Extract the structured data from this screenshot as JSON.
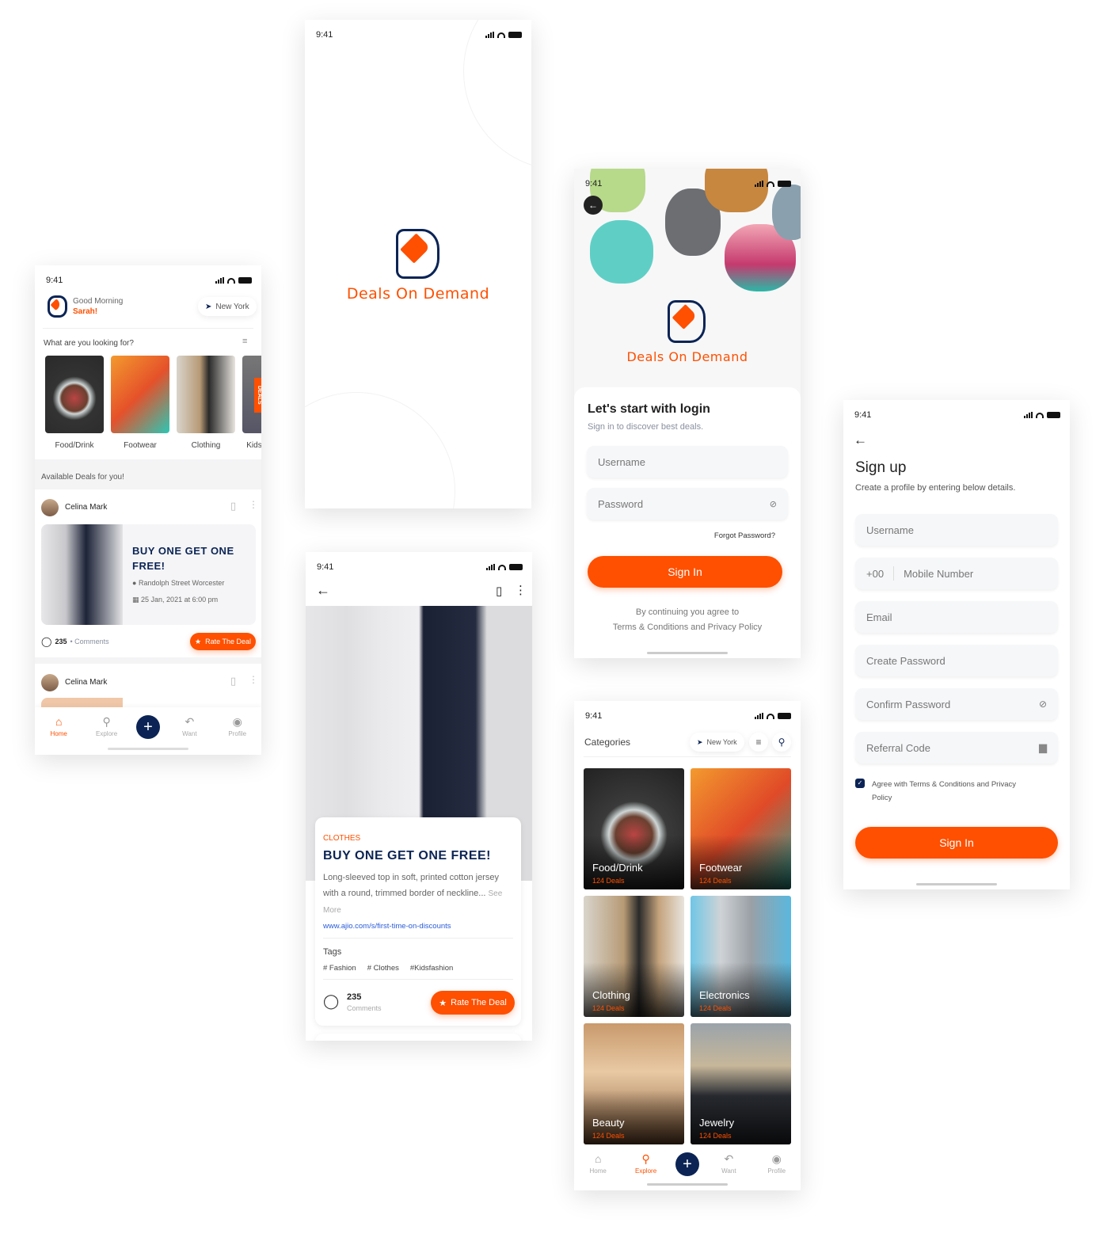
{
  "brand": {
    "name": "Deals On Demand",
    "orange": "#fe5000",
    "navy": "#0b2455"
  },
  "status_time": "9:41",
  "home": {
    "greeting": "Good Morning",
    "user": "Sarah!",
    "location": "New York",
    "looking_for": "What are you looking for?",
    "categories": [
      "Food/Drink",
      "Footwear",
      "Clothing",
      "Kids"
    ],
    "deals_ribbon": "DEALS",
    "available": "Available Deals for you!",
    "post": {
      "author": "Celina Mark",
      "title": "BUY ONE GET ONE FREE!",
      "place": "Randolph Street Worcester",
      "date": "25 Jan, 2021 at 6:00 pm",
      "comments_count": "235",
      "comments_label": "• Comments",
      "rate": "Rate The Deal"
    },
    "post2_author": "Celina Mark"
  },
  "nav": {
    "home": "Home",
    "explore": "Explore",
    "want": "Want",
    "profile": "Profile"
  },
  "detail": {
    "category": "CLOTHES",
    "title": "BUY ONE GET ONE FREE!",
    "desc": "Long-sleeved top in soft, printed cotton jersey with a round, trimmed border of neckline...",
    "see_more": "See More",
    "link": "www.ajio.com/s/first-time-on-discounts",
    "tags_label": "Tags",
    "tags": [
      "# Fashion",
      "# Clothes",
      "#Kidsfashion"
    ],
    "comments_count": "235",
    "comments_label": "Comments",
    "rate": "Rate The Deal"
  },
  "login": {
    "title": "Let's start with login",
    "subtitle": "Sign in to discover best deals.",
    "username": "Username",
    "password": "Password",
    "forgot": "Forgot Password?",
    "sign_in": "Sign In",
    "agree1": "By continuing you agree to",
    "agree2": "Terms & Conditions and Privacy Policy"
  },
  "categories": {
    "title": "Categories",
    "location": "New York",
    "items": [
      {
        "name": "Food/Drink",
        "deals": "124 Deals"
      },
      {
        "name": "Footwear",
        "deals": "124 Deals"
      },
      {
        "name": "Clothing",
        "deals": "124 Deals"
      },
      {
        "name": "Electronics",
        "deals": "124 Deals"
      },
      {
        "name": "Beauty",
        "deals": "124 Deals"
      },
      {
        "name": "Jewelry",
        "deals": "124 Deals"
      }
    ]
  },
  "signup": {
    "title": "Sign up",
    "subtitle": "Create a profile by entering below details.",
    "username": "Username",
    "code": "+00",
    "mobile": "Mobile Number",
    "email": "Email",
    "create_password": "Create Password",
    "confirm_password": "Confirm Password",
    "referral": "Referral Code",
    "agree": "Agree with Terms & Conditions and Privacy Policy",
    "agree_checked": true,
    "sign_in": "Sign In"
  }
}
